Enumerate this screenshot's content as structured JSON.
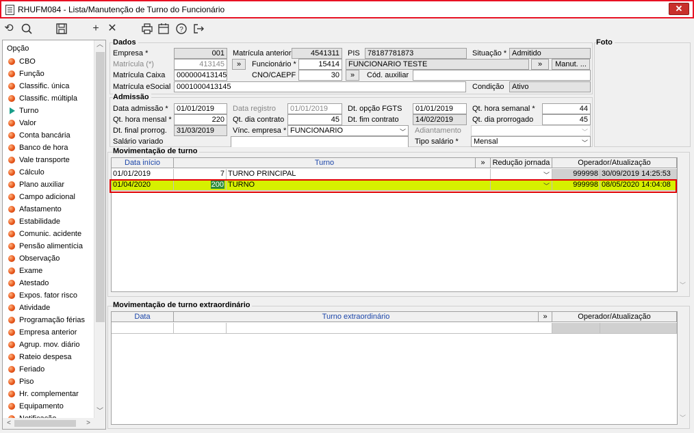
{
  "window": {
    "title": "RHUFM084 - Lista/Manutenção de Turno do Funcionário",
    "close_label": "✕"
  },
  "toolbar": {
    "icons": [
      "undo-icon",
      "search-icon",
      "save-icon",
      "add-icon",
      "delete-icon",
      "print-icon",
      "calendar-icon",
      "help-icon",
      "exit-icon"
    ]
  },
  "nav": {
    "header": "Opção",
    "items": [
      {
        "label": "CBO"
      },
      {
        "label": "Função"
      },
      {
        "label": "Classific. única"
      },
      {
        "label": "Classific. múltipla"
      },
      {
        "label": "Turno",
        "active": true
      },
      {
        "label": "Valor"
      },
      {
        "label": "Conta bancária"
      },
      {
        "label": "Banco de hora"
      },
      {
        "label": "Vale transporte"
      },
      {
        "label": "Cálculo"
      },
      {
        "label": "Plano auxiliar"
      },
      {
        "label": "Campo adicional"
      },
      {
        "label": "Afastamento"
      },
      {
        "label": "Estabilidade"
      },
      {
        "label": "Comunic. acidente"
      },
      {
        "label": "Pensão alimentícia"
      },
      {
        "label": "Observação"
      },
      {
        "label": "Exame"
      },
      {
        "label": "Atestado"
      },
      {
        "label": "Expos. fator risco"
      },
      {
        "label": "Atividade"
      },
      {
        "label": "Programação férias"
      },
      {
        "label": "Empresa anterior"
      },
      {
        "label": "Agrup. mov. diário"
      },
      {
        "label": "Rateio despesa"
      },
      {
        "label": "Feriado"
      },
      {
        "label": "Piso"
      },
      {
        "label": "Hr. complementar"
      },
      {
        "label": "Equipamento"
      },
      {
        "label": "Notificação"
      }
    ]
  },
  "dados": {
    "title": "Dados",
    "empresa_label": "Empresa *",
    "empresa": "001",
    "matricula_label": "Matrícula (*)",
    "matricula": "413145",
    "matricula_caixa_label": "Matrícula Caixa",
    "matricula_caixa": "000000413145",
    "matricula_esocial_label": "Matrícula eSocial",
    "matricula_esocial": "0001000413145",
    "matricula_anterior_label": "Matrícula anterior",
    "matricula_anterior": "4541311",
    "funcionario_label": "Funcionário *",
    "funcionario_id": "15414",
    "funcionario_nome": "FUNCIONARIO TESTE",
    "cno_label": "CNO/CAEPF",
    "cno": "30",
    "pis_label": "PIS",
    "pis": "78187781873",
    "cod_auxiliar_label": "Cód. auxiliar",
    "cod_auxiliar": "",
    "situacao_label": "Situação *",
    "situacao": "Admitido",
    "condicao_label": "Condição",
    "condicao": "Ativo",
    "manut_label": "Manut. ...",
    "chevron": "»"
  },
  "foto": {
    "title": "Foto"
  },
  "admissao": {
    "title": "Admissão",
    "data_admissao_label": "Data admissão *",
    "data_admissao": "01/01/2019",
    "qt_hora_mensal_label": "Qt. hora mensal *",
    "qt_hora_mensal": "220",
    "dt_final_prorrog_label": "Dt. final prorrog.",
    "dt_final_prorrog": "31/03/2019",
    "salario_variado_label": "Salário variado",
    "data_registro_label": "Data registro",
    "data_registro": "01/01/2019",
    "qt_dia_contrato_label": "Qt. dia contrato",
    "qt_dia_contrato": "45",
    "vinc_empresa_label": "Vínc. empresa *",
    "vinc_empresa": "FUNCIONARIO",
    "dt_opcao_fgts_label": "Dt. opção FGTS",
    "dt_opcao_fgts": "01/01/2019",
    "dt_fim_contrato_label": "Dt. fim contrato",
    "dt_fim_contrato": "14/02/2019",
    "adiantamento_label": "Adiantamento",
    "tipo_salario_label": "Tipo salário *",
    "tipo_salario": "Mensal",
    "qt_hora_semanal_label": "Qt. hora semanal *",
    "qt_hora_semanal": "44",
    "qt_dia_prorrogado_label": "Qt. dia prorrogado",
    "qt_dia_prorrogado": "45"
  },
  "mov_turno": {
    "title": "Movimentação de turno",
    "headers": {
      "data_inicio": "Data início",
      "turno": "Turno",
      "chevron": "»",
      "reducao": "Redução jornada",
      "operador": "Operador/Atualização"
    },
    "rows": [
      {
        "data": "01/01/2019",
        "cod": "7",
        "turno": "TURNO PRINCIPAL",
        "operador": "999998",
        "atualizacao": "30/09/2019 14:25:53"
      },
      {
        "data": "01/04/2020",
        "cod": "200",
        "turno": "TURNO",
        "operador": "999998",
        "atualizacao": "08/05/2020 14:04:08"
      }
    ]
  },
  "mov_extra": {
    "title": "Movimentação de turno extraordinário",
    "headers": {
      "data": "Data",
      "turno": "Turno extraordinário",
      "chevron": "»",
      "operador": "Operador/Atualização"
    }
  },
  "colors": {
    "selected_row": "#d6f000",
    "outline": "#e00000",
    "header_text": "#1a44a8"
  }
}
